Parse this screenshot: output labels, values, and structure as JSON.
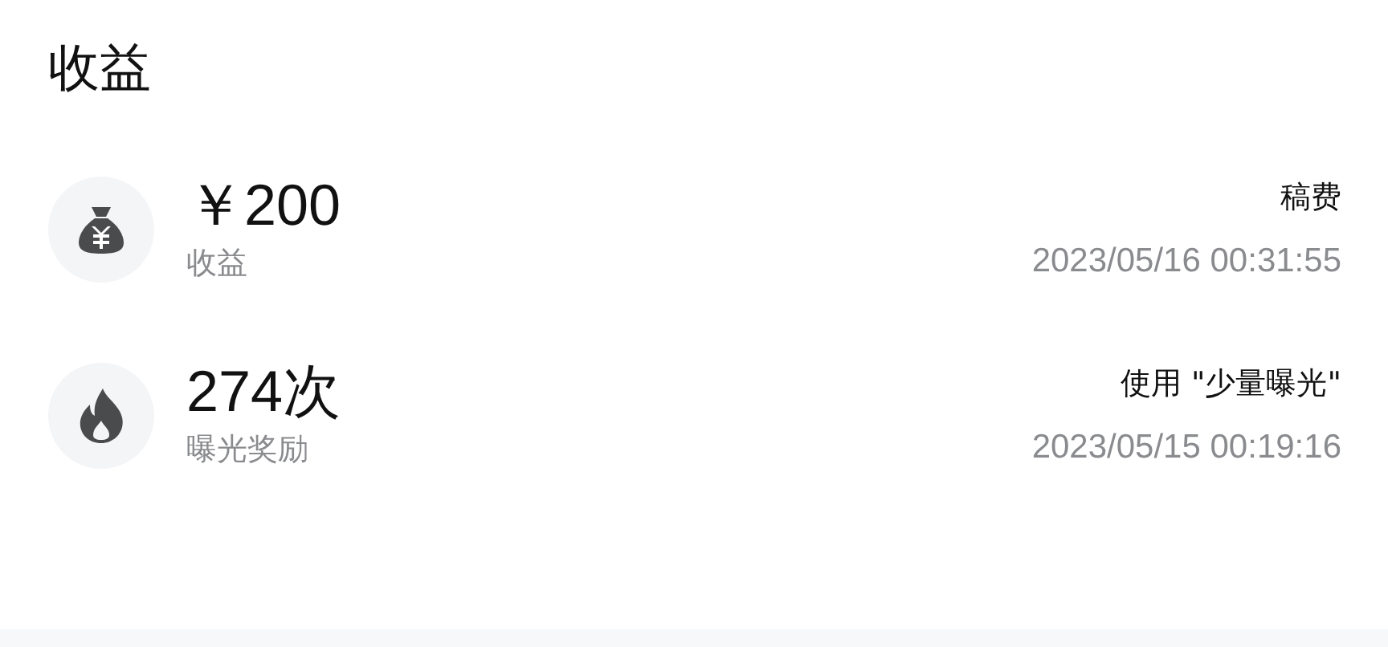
{
  "title": "收益",
  "records": [
    {
      "kind": "money",
      "amount": "￥200",
      "label": "收益",
      "source": "稿费",
      "time": "2023/05/16 00:31:55"
    },
    {
      "kind": "fire",
      "amount": "274次",
      "label": "曝光奖励",
      "source": "使用 \"少量曝光\"",
      "time": "2023/05/15 00:19:16"
    }
  ]
}
